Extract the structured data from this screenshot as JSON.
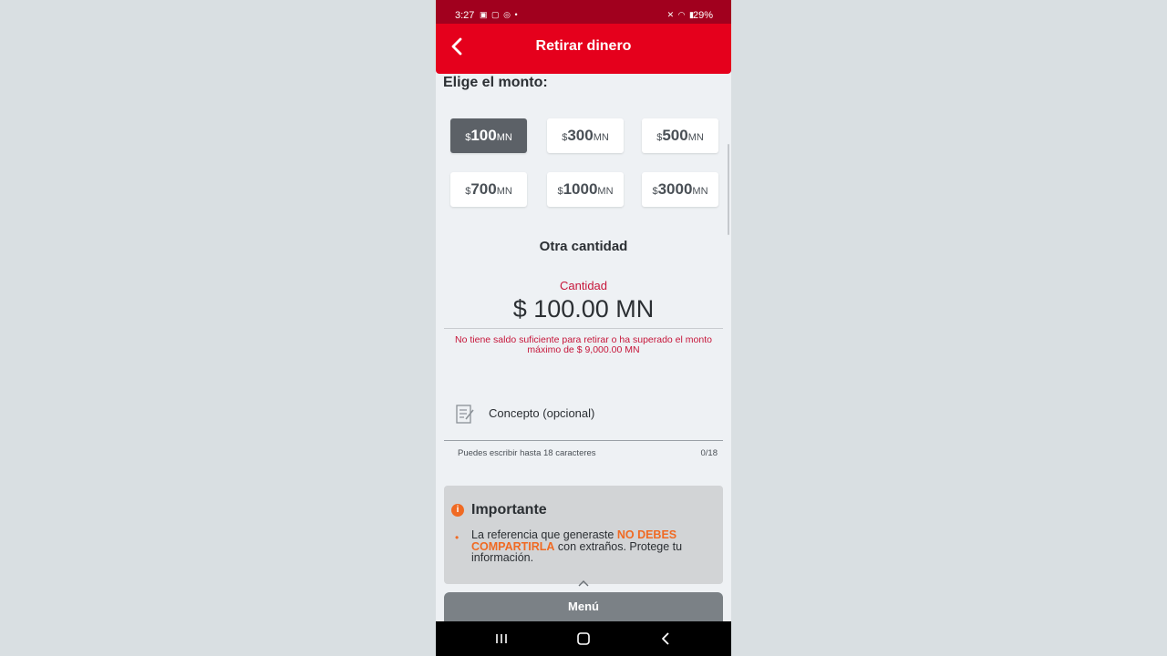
{
  "status_bar": {
    "time": "3:27",
    "left_icons": [
      "screenshot-icon",
      "screen-record-icon",
      "instagram-icon",
      "dot-icon"
    ],
    "right_icons": [
      "mute-icon",
      "wifi-icon",
      "signal-icon"
    ],
    "battery": "29%"
  },
  "app_bar": {
    "title": "Retirar dinero",
    "back_icon": "back-arrow-icon"
  },
  "amount_section": {
    "heading": "Elige el monto:",
    "currency_symbol": "$",
    "unit": "MN",
    "options": [
      {
        "value": "100",
        "selected": true
      },
      {
        "value": "300",
        "selected": false
      },
      {
        "value": "500",
        "selected": false
      },
      {
        "value": "700",
        "selected": false
      },
      {
        "value": "1000",
        "selected": false
      },
      {
        "value": "3000",
        "selected": false
      }
    ]
  },
  "other_amount": {
    "title": "Otra cantidad",
    "label": "Cantidad",
    "value": "$ 100.00 MN",
    "error": "No tiene saldo suficiente para retirar o ha superado el monto máximo de $ 9,000.00 MN"
  },
  "concept": {
    "icon": "note-edit-icon",
    "placeholder": "Concepto (opcional)",
    "helper": "Puedes escribir hasta 18 caracteres",
    "counter": "0/18"
  },
  "notice": {
    "icon": "info-icon",
    "title": "Importante",
    "text_before": "La referencia que generaste ",
    "text_highlight": "NO DEBES COMPARTIRLA",
    "text_after": " con extraños. Protege tu información."
  },
  "bottom_menu": {
    "label": "Menú"
  },
  "navigation": {
    "buttons": [
      "recent-apps-icon",
      "home-icon",
      "back-icon"
    ]
  },
  "colors": {
    "brand_red": "#e5001c",
    "status_bar": "#a1001e",
    "error": "#c6163a",
    "accent_orange": "#f06a23",
    "selected_option": "#5c6167"
  }
}
